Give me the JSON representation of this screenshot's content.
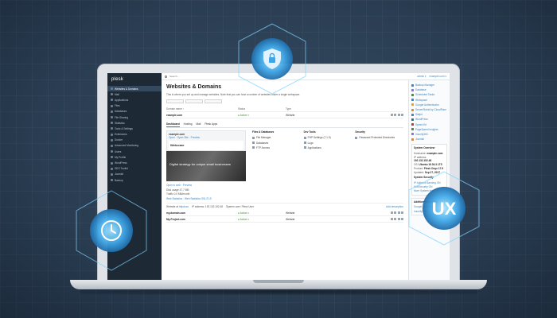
{
  "app": {
    "logo": "plesk",
    "search_placeholder": "Search...",
    "top_user": "admin ▾",
    "top_domain": "example.com ▾"
  },
  "sidebar": {
    "items": [
      {
        "label": "Websites & Domains",
        "active": true
      },
      {
        "label": "Mail"
      },
      {
        "label": "Applications"
      },
      {
        "label": "Files"
      },
      {
        "label": "Databases"
      },
      {
        "label": "File Sharing"
      },
      {
        "label": "Statistics"
      },
      {
        "label": "Tools & Settings"
      },
      {
        "label": "Extensions"
      },
      {
        "label": "Docker"
      },
      {
        "label": "Advanced Monitoring"
      },
      {
        "label": "Users"
      },
      {
        "label": "My Profile"
      },
      {
        "label": "WordPress"
      },
      {
        "label": "SEO Toolkit"
      },
      {
        "label": "Joomla!"
      },
      {
        "label": "Backup"
      }
    ]
  },
  "main": {
    "title": "Websites & Domains",
    "description": "This is where you set up and manage websites. Note that you can host a number of websites under a single webspace.",
    "columns": [
      "Domain name ↑",
      "Status",
      "Type"
    ],
    "tabs": [
      {
        "label": "Dashboard",
        "active": true
      },
      {
        "label": "Hosting"
      },
      {
        "label": "Mail"
      },
      {
        "label": "Plesk Apps"
      }
    ],
    "domains": [
      {
        "name": "example.com",
        "status": "● Active ▾",
        "type": "Website"
      },
      {
        "name": "my.domain.com",
        "status": "● Active ▾",
        "type": "Website"
      },
      {
        "name": "My-Project.com",
        "status": "● Active ▾",
        "type": "Website"
      }
    ],
    "preview": {
      "head": "example.com",
      "sub": "Open · Open Site · Preview",
      "welcome": "Welcome",
      "tagline": "Digital strategy for unique small businesses",
      "open_in_web": "Open in web",
      "preview": "Preview",
      "disk_usage": "Disk usage 47.7 MB",
      "traffic": "Traffic 0.0 MB/month",
      "web_statistics": "Web Statistics",
      "web_statistics_ssl": "Web Statistics SSL/TLS"
    },
    "feature_cols": [
      {
        "title": "Files & Databases",
        "items": [
          "File Manager",
          "Databases",
          "FTP Access"
        ]
      },
      {
        "title": "Dev Tools",
        "items": [
          "PHP Settings (7.1.9)",
          "Logs",
          "Applications"
        ]
      },
      {
        "title": "Security",
        "items": [
          "Password-Protected Directories"
        ]
      }
    ],
    "web_bar": {
      "prefix": "Website at",
      "link": "httpdocs",
      "ip": "IP address: 192.132.152.48",
      "user": "System user: Plesk User",
      "add": "Add description"
    }
  },
  "right_panel": {
    "tools": [
      {
        "label": "Backup Manager",
        "color": "#3a84c3"
      },
      {
        "label": "Database",
        "color": "#8e6fd8"
      },
      {
        "label": "Scheduled Tasks",
        "color": "#4a8a3e"
      },
      {
        "label": "Webspace",
        "color": "#3a84c3"
      },
      {
        "label": "Google Authenticator",
        "color": "#e0a12b"
      },
      {
        "label": "ServerShield by CloudFlare",
        "color": "#f38020"
      },
      {
        "label": "Sitejet",
        "color": "#3a84c3"
      },
      {
        "label": "WordPress",
        "color": "#21759b"
      },
      {
        "label": "Speed Kit",
        "color": "#c0392b"
      },
      {
        "label": "PageSpeed Insights",
        "color": "#4a8a3e"
      },
      {
        "label": "Imunify360",
        "color": "#8e6fd8"
      },
      {
        "label": "Joomla!",
        "color": "#f38020"
      }
    ],
    "system_overview": {
      "title": "System Overview",
      "lines": [
        {
          "k": "Hostname:",
          "v": "example.com"
        },
        {
          "k": "IP address:",
          "v": "192.132.152.48"
        },
        {
          "k": "OS:",
          "v": "Ubuntu 16.04.3 LTS"
        },
        {
          "k": "Product:",
          "v": "Plesk Onyx 17.5"
        },
        {
          "k": "Updated:",
          "v": "Sep 27, 2017"
        }
      ],
      "security_title": "System Security",
      "security_lines": [
        "IP Address Banning ON",
        "ModSecurity ON"
      ],
      "more": "More System Info"
    },
    "additional": {
      "title": "Additional Services",
      "links": [
        "Google Authenticator",
        "Imunify360"
      ]
    }
  },
  "badges": {
    "ux": "UX"
  },
  "colors": {
    "background": "#2a3d52",
    "sidebar": "#1d2a36",
    "accent": "#3a84c3",
    "glow": "#5fc3ff"
  }
}
